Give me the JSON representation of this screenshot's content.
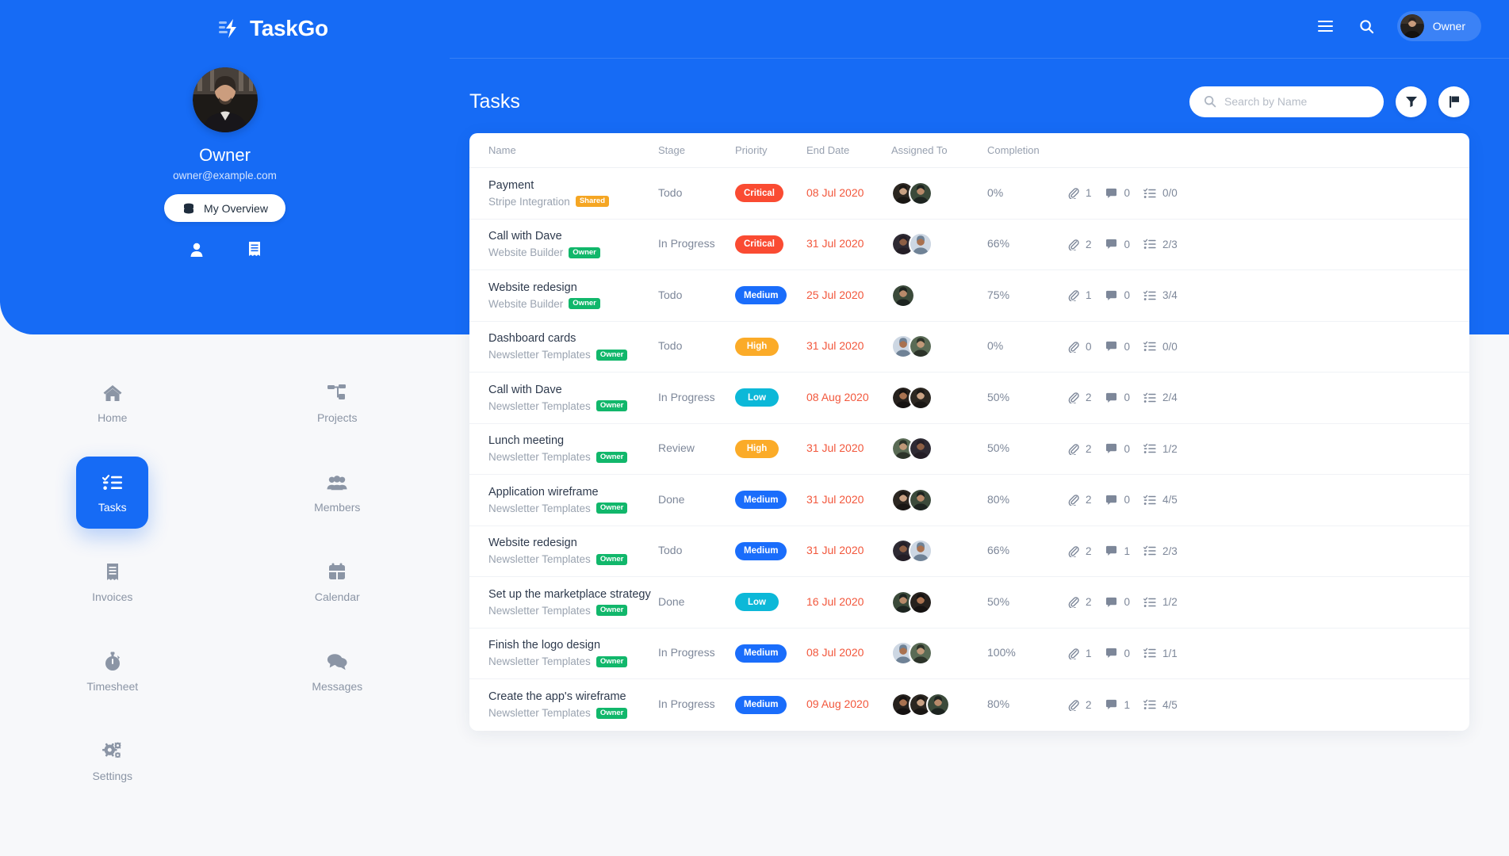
{
  "brand": {
    "name": "TaskGo",
    "logo_icon": "lightning-bolt-icon"
  },
  "topbar": {
    "menu_icon": "hamburger-menu-icon",
    "search_icon": "search-icon",
    "user_name": "Owner",
    "avatar_icon": "user-avatar"
  },
  "profile": {
    "name": "Owner",
    "email": "owner@example.com",
    "overview_label": "My Overview",
    "overview_icon": "coins-stack-icon",
    "mini_icons": [
      "person-icon",
      "receipt-icon"
    ]
  },
  "sidebar": {
    "items": [
      {
        "label": "Home",
        "icon": "home-icon",
        "active": false
      },
      {
        "label": "Projects",
        "icon": "projects-icon",
        "active": false
      },
      {
        "label": "Tasks",
        "icon": "tasks-icon",
        "active": true
      },
      {
        "label": "Members",
        "icon": "members-icon",
        "active": false
      },
      {
        "label": "Invoices",
        "icon": "receipt-icon",
        "active": false
      },
      {
        "label": "Calendar",
        "icon": "calendar-icon",
        "active": false
      },
      {
        "label": "Timesheet",
        "icon": "stopwatch-icon",
        "active": false
      },
      {
        "label": "Messages",
        "icon": "chat-icon",
        "active": false
      },
      {
        "label": "Settings",
        "icon": "gears-icon",
        "active": false
      }
    ]
  },
  "page": {
    "title": "Tasks",
    "search_placeholder": "Search by Name",
    "search_value": "",
    "search_icon": "search-icon",
    "filter_icon": "funnel-filter-icon",
    "flag_icon": "flag-icon"
  },
  "colors": {
    "brand_blue": "#166bf5",
    "critical": "#fa4b32",
    "medium": "#1a6dfb",
    "high": "#fbab28",
    "low": "#0cb8d8",
    "owner_badge": "#11b76b",
    "shared_badge": "#f5a623",
    "date_red": "#f2573c",
    "page_bg": "#f7f8fa"
  },
  "table": {
    "columns": [
      "Name",
      "Stage",
      "Priority",
      "End Date",
      "Assigned To",
      "Completion"
    ],
    "rows": [
      {
        "name": "Payment",
        "project": "Stripe Integration",
        "tag": "Shared",
        "tag_type": "shared",
        "stage": "Todo",
        "priority": "Critical",
        "priority_class": "b-critical",
        "end_date": "08 Jul 2020",
        "assignees": 2,
        "completion": "0%",
        "attachments": "1",
        "comments": "0",
        "checklist": "0/0"
      },
      {
        "name": "Call with Dave",
        "project": "Website Builder",
        "tag": "Owner",
        "tag_type": "owner",
        "stage": "In Progress",
        "priority": "Critical",
        "priority_class": "b-critical",
        "end_date": "31 Jul 2020",
        "assignees": 2,
        "completion": "66%",
        "attachments": "2",
        "comments": "0",
        "checklist": "2/3"
      },
      {
        "name": "Website redesign",
        "project": "Website Builder",
        "tag": "Owner",
        "tag_type": "owner",
        "stage": "Todo",
        "priority": "Medium",
        "priority_class": "b-medium",
        "end_date": "25 Jul 2020",
        "assignees": 1,
        "completion": "75%",
        "attachments": "1",
        "comments": "0",
        "checklist": "3/4"
      },
      {
        "name": "Dashboard cards",
        "project": "Newsletter Templates",
        "tag": "Owner",
        "tag_type": "owner",
        "stage": "Todo",
        "priority": "High",
        "priority_class": "b-high",
        "end_date": "31 Jul 2020",
        "assignees": 2,
        "completion": "0%",
        "attachments": "0",
        "comments": "0",
        "checklist": "0/0"
      },
      {
        "name": "Call with Dave",
        "project": "Newsletter Templates",
        "tag": "Owner",
        "tag_type": "owner",
        "stage": "In Progress",
        "priority": "Low",
        "priority_class": "b-low",
        "end_date": "08 Aug 2020",
        "assignees": 2,
        "completion": "50%",
        "attachments": "2",
        "comments": "0",
        "checklist": "2/4"
      },
      {
        "name": "Lunch meeting",
        "project": "Newsletter Templates",
        "tag": "Owner",
        "tag_type": "owner",
        "stage": "Review",
        "priority": "High",
        "priority_class": "b-high",
        "end_date": "31 Jul 2020",
        "assignees": 2,
        "completion": "50%",
        "attachments": "2",
        "comments": "0",
        "checklist": "1/2"
      },
      {
        "name": "Application wireframe",
        "project": "Newsletter Templates",
        "tag": "Owner",
        "tag_type": "owner",
        "stage": "Done",
        "priority": "Medium",
        "priority_class": "b-medium",
        "end_date": "31 Jul 2020",
        "assignees": 2,
        "completion": "80%",
        "attachments": "2",
        "comments": "0",
        "checklist": "4/5"
      },
      {
        "name": "Website redesign",
        "project": "Newsletter Templates",
        "tag": "Owner",
        "tag_type": "owner",
        "stage": "Todo",
        "priority": "Medium",
        "priority_class": "b-medium",
        "end_date": "31 Jul 2020",
        "assignees": 2,
        "completion": "66%",
        "attachments": "2",
        "comments": "1",
        "checklist": "2/3"
      },
      {
        "name": "Set up the marketplace strategy",
        "project": "Newsletter Templates",
        "tag": "Owner",
        "tag_type": "owner",
        "stage": "Done",
        "priority": "Low",
        "priority_class": "b-low",
        "end_date": "16 Jul 2020",
        "assignees": 2,
        "completion": "50%",
        "attachments": "2",
        "comments": "0",
        "checklist": "1/2"
      },
      {
        "name": "Finish the logo design",
        "project": "Newsletter Templates",
        "tag": "Owner",
        "tag_type": "owner",
        "stage": "In Progress",
        "priority": "Medium",
        "priority_class": "b-medium",
        "end_date": "08 Jul 2020",
        "assignees": 2,
        "completion": "100%",
        "attachments": "1",
        "comments": "0",
        "checklist": "1/1"
      },
      {
        "name": "Create the app's wireframe",
        "project": "Newsletter Templates",
        "tag": "Owner",
        "tag_type": "owner",
        "stage": "In Progress",
        "priority": "Medium",
        "priority_class": "b-medium",
        "end_date": "09 Aug 2020",
        "assignees": 3,
        "completion": "80%",
        "attachments": "2",
        "comments": "1",
        "checklist": "4/5"
      }
    ]
  }
}
